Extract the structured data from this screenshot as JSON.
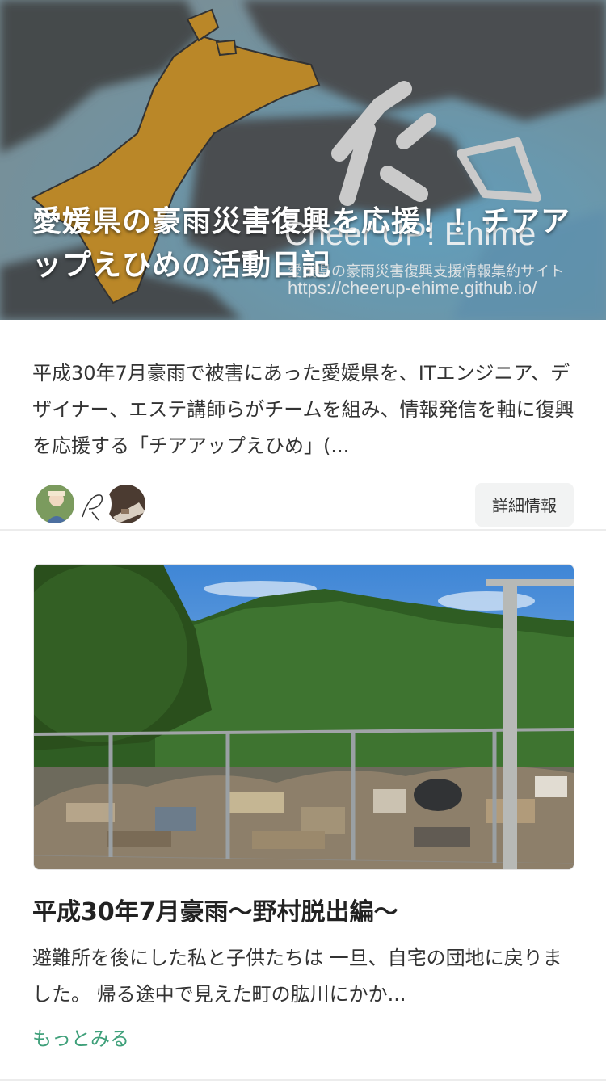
{
  "hero": {
    "title": "愛媛県の豪雨災害復興を応援！！チアアップえひめの活動日記",
    "site_name": "Cheer UP! Ehime",
    "subtitle": "愛媛県の豪雨災害復興支援情報集約サイト",
    "url": "https://cheerup-ehime.github.io/"
  },
  "card": {
    "description": "平成30年7月豪雨で被害にあった愛媛県を、ITエンジニア、デザイナー、エステ講師らがチームを組み、情報発信を軸に復興を応援する「チアアップえひめ」(...",
    "details_label": "詳細情報"
  },
  "post": {
    "title": "平成30年7月豪雨〜野村脱出編〜",
    "excerpt": "避難所を後にした私と子供たちは 一旦、自宅の団地に戻りました。 帰る途中で見えた町の肱川にかか...",
    "more_label": "もっとみる"
  },
  "colors": {
    "accent": "#3fa07a",
    "map_highlight": "#d49a2e"
  }
}
